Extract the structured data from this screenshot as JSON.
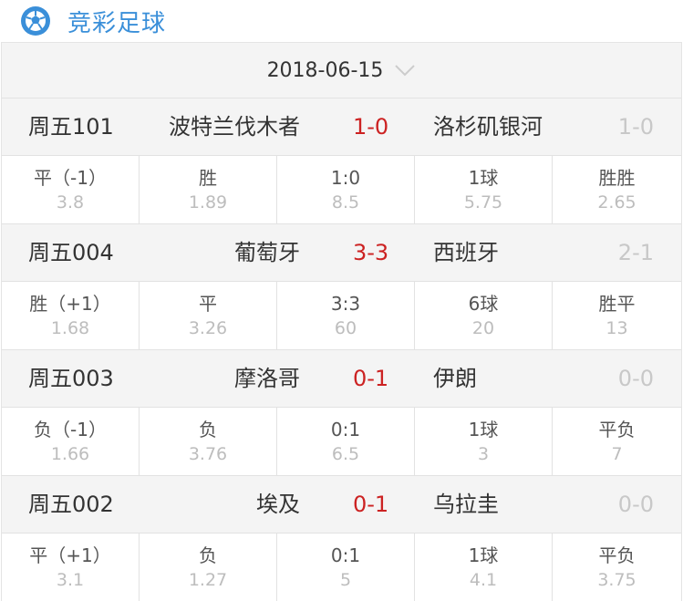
{
  "header": {
    "title": "竞彩足球",
    "icon": "soccer-ball-icon"
  },
  "date_selector": {
    "date": "2018-06-15",
    "icon": "chevron-down-icon"
  },
  "colors": {
    "accent": "#3a8fd9",
    "score": "#cc2222",
    "muted": "#bdbdbd"
  },
  "matches": [
    {
      "id": "周五101",
      "home": "波特兰伐木者",
      "score": "1-0",
      "away": "洛杉矶银河",
      "half": "1-0",
      "odds": [
        {
          "label": "平（-1）",
          "value": "3.8"
        },
        {
          "label": "胜",
          "value": "1.89"
        },
        {
          "label": "1:0",
          "value": "8.5"
        },
        {
          "label": "1球",
          "value": "5.75"
        },
        {
          "label": "胜胜",
          "value": "2.65"
        }
      ]
    },
    {
      "id": "周五004",
      "home": "葡萄牙",
      "score": "3-3",
      "away": "西班牙",
      "half": "2-1",
      "odds": [
        {
          "label": "胜（+1）",
          "value": "1.68"
        },
        {
          "label": "平",
          "value": "3.26"
        },
        {
          "label": "3:3",
          "value": "60"
        },
        {
          "label": "6球",
          "value": "20"
        },
        {
          "label": "胜平",
          "value": "13"
        }
      ]
    },
    {
      "id": "周五003",
      "home": "摩洛哥",
      "score": "0-1",
      "away": "伊朗",
      "half": "0-0",
      "odds": [
        {
          "label": "负（-1）",
          "value": "1.66"
        },
        {
          "label": "负",
          "value": "3.76"
        },
        {
          "label": "0:1",
          "value": "6.5"
        },
        {
          "label": "1球",
          "value": "3"
        },
        {
          "label": "平负",
          "value": "7"
        }
      ]
    },
    {
      "id": "周五002",
      "home": "埃及",
      "score": "0-1",
      "away": "乌拉圭",
      "half": "0-0",
      "odds": [
        {
          "label": "平（+1）",
          "value": "3.1"
        },
        {
          "label": "负",
          "value": "1.27"
        },
        {
          "label": "0:1",
          "value": "5"
        },
        {
          "label": "1球",
          "value": "4.1"
        },
        {
          "label": "平负",
          "value": "3.75"
        }
      ]
    }
  ]
}
